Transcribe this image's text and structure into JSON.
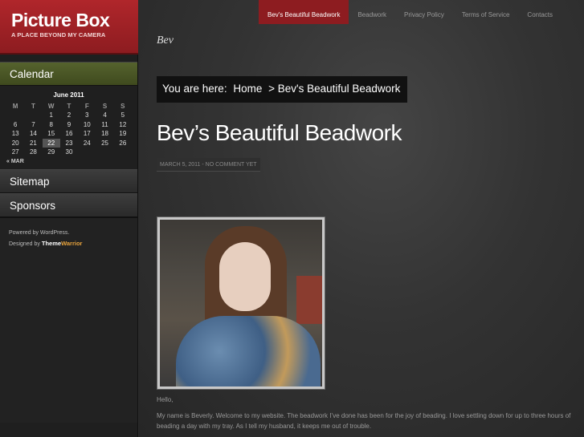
{
  "site": {
    "title": "Picture Box",
    "tagline": "A PLACE BEYOND MY CAMERA"
  },
  "nav": {
    "items": [
      {
        "label": "Bev's Beautiful Beadwork",
        "active": true
      },
      {
        "label": "Beadwork",
        "active": false
      },
      {
        "label": "Privacy Policy",
        "active": false
      },
      {
        "label": "Terms of Service",
        "active": false
      },
      {
        "label": "Contacts",
        "active": false
      }
    ]
  },
  "sidebar": {
    "calendar_title": "Calendar",
    "calendar": {
      "caption": "June 2011",
      "weekdays": [
        "M",
        "T",
        "W",
        "T",
        "F",
        "S",
        "S"
      ],
      "weeks": [
        [
          "",
          "",
          "1",
          "2",
          "3",
          "4",
          "5"
        ],
        [
          "6",
          "7",
          "8",
          "9",
          "10",
          "11",
          "12"
        ],
        [
          "13",
          "14",
          "15",
          "16",
          "17",
          "18",
          "19"
        ],
        [
          "20",
          "21",
          "22",
          "23",
          "24",
          "25",
          "26"
        ],
        [
          "27",
          "28",
          "29",
          "30",
          "",
          "",
          ""
        ]
      ],
      "today": "22",
      "prev_link": "« MAR"
    },
    "sitemap_title": "Sitemap",
    "sponsors_title": "Sponsors",
    "powered_by": "Powered by WordPress.",
    "designed_by_prefix": "Designed by",
    "designer_brand_a": "Theme",
    "designer_brand_b": "Warrior"
  },
  "main": {
    "blog_name": "Bev",
    "breadcrumb": {
      "prefix": "You are here:",
      "home": "Home",
      "current": "> Bev's Beautiful Beadwork"
    },
    "post_title": "Bev’s Beautiful Beadwork",
    "post_meta": "MARCH 5, 2011 - NO COMMENT YET",
    "body": {
      "greeting": "Hello,",
      "paragraph1": "My name is Beverly. Welcome to my website. The beadwork I’ve done has been for the joy of beading. I love settling down for up to three hours of beading a day with my tray.  As I tell my husband, it keeps me out of trouble."
    }
  },
  "colors": {
    "accent_red": "#8d1c20",
    "calendar_green": "#55622d"
  }
}
